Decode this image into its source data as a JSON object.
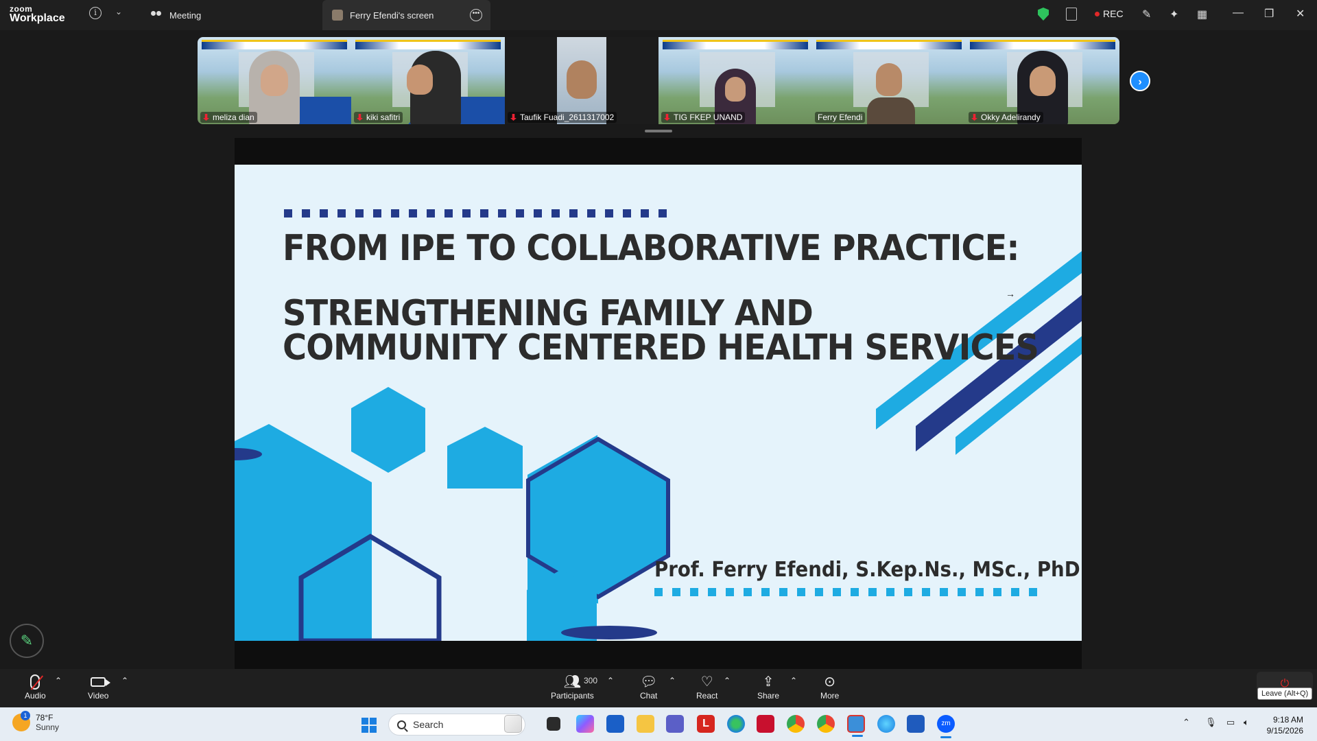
{
  "app": {
    "brand_top": "zoom",
    "brand_bottom": "Workplace"
  },
  "titlebar": {
    "meeting_tab": "Meeting",
    "screen_tab": "Ferry Efendi's screen",
    "rec_label": "REC"
  },
  "participants_strip": [
    {
      "name": "meliza dian",
      "muted": true
    },
    {
      "name": "kiki safitri",
      "muted": true
    },
    {
      "name": "Taufik Fuadi_2611317002",
      "muted": true
    },
    {
      "name": "TIG FKEP UNAND",
      "muted": true
    },
    {
      "name": "Ferry Efendi",
      "muted": false,
      "active_speaker": true
    },
    {
      "name": "Okky Adelirandy",
      "muted": true
    }
  ],
  "slide": {
    "title_line1": "FROM IPE TO COLLABORATIVE PRACTICE:",
    "title_line2": "STRENGTHENING FAMILY AND",
    "title_line3": "COMMUNITY CENTERED HEALTH SERVICES",
    "author": "Prof. Ferry Efendi, S.Kep.Ns., MSc., PhD",
    "colors": {
      "background": "#e5f3fb",
      "dark_blue": "#243a8a",
      "light_blue": "#1eabe2",
      "text": "#2c2c2c"
    }
  },
  "toolbar": {
    "audio": "Audio",
    "video": "Video",
    "participants": "Participants",
    "participants_count": "300",
    "chat": "Chat",
    "react": "React",
    "share": "Share",
    "more": "More",
    "leave_tooltip": "Leave (Alt+Q)"
  },
  "taskbar": {
    "weather_temp": "78°F",
    "weather_desc": "Sunny",
    "weather_badge": "1",
    "search_placeholder": "Search",
    "time": "9:18 AM",
    "date": "9/15/2026"
  }
}
